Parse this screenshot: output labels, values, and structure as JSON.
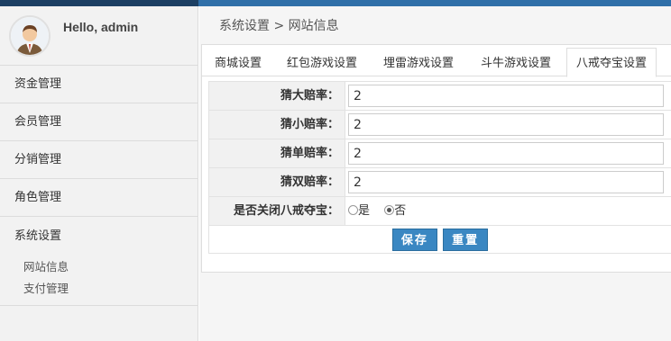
{
  "header": {
    "greeting": "Hello, admin"
  },
  "sidebar": {
    "items": [
      {
        "label": "资金管理"
      },
      {
        "label": "会员管理"
      },
      {
        "label": "分销管理"
      },
      {
        "label": "角色管理"
      }
    ],
    "group": {
      "label": "系统设置",
      "subitems": [
        {
          "label": "网站信息"
        },
        {
          "label": "支付管理"
        }
      ]
    }
  },
  "breadcrumb": "系统设置 > 网站信息",
  "tabs": [
    {
      "label": "商城设置"
    },
    {
      "label": "红包游戏设置"
    },
    {
      "label": "埋雷游戏设置"
    },
    {
      "label": "斗牛游戏设置"
    },
    {
      "label": "八戒夺宝设置",
      "active": true
    }
  ],
  "form": {
    "fields": [
      {
        "label": "猜大赔率：",
        "value": "2"
      },
      {
        "label": "猜小赔率：",
        "value": "2"
      },
      {
        "label": "猜单赔率：",
        "value": "2"
      },
      {
        "label": "猜双赔率：",
        "value": "2"
      }
    ],
    "close_label": "是否关闭八戒夺宝：",
    "radio_yes": "是",
    "radio_no": "否",
    "radio_selected": "否",
    "save_label": "保存",
    "reset_label": "重置"
  },
  "colors": {
    "primary_button": "#3a87c2",
    "topbar": "#2f6fa8"
  },
  "icons": {
    "avatar": "user-avatar"
  }
}
